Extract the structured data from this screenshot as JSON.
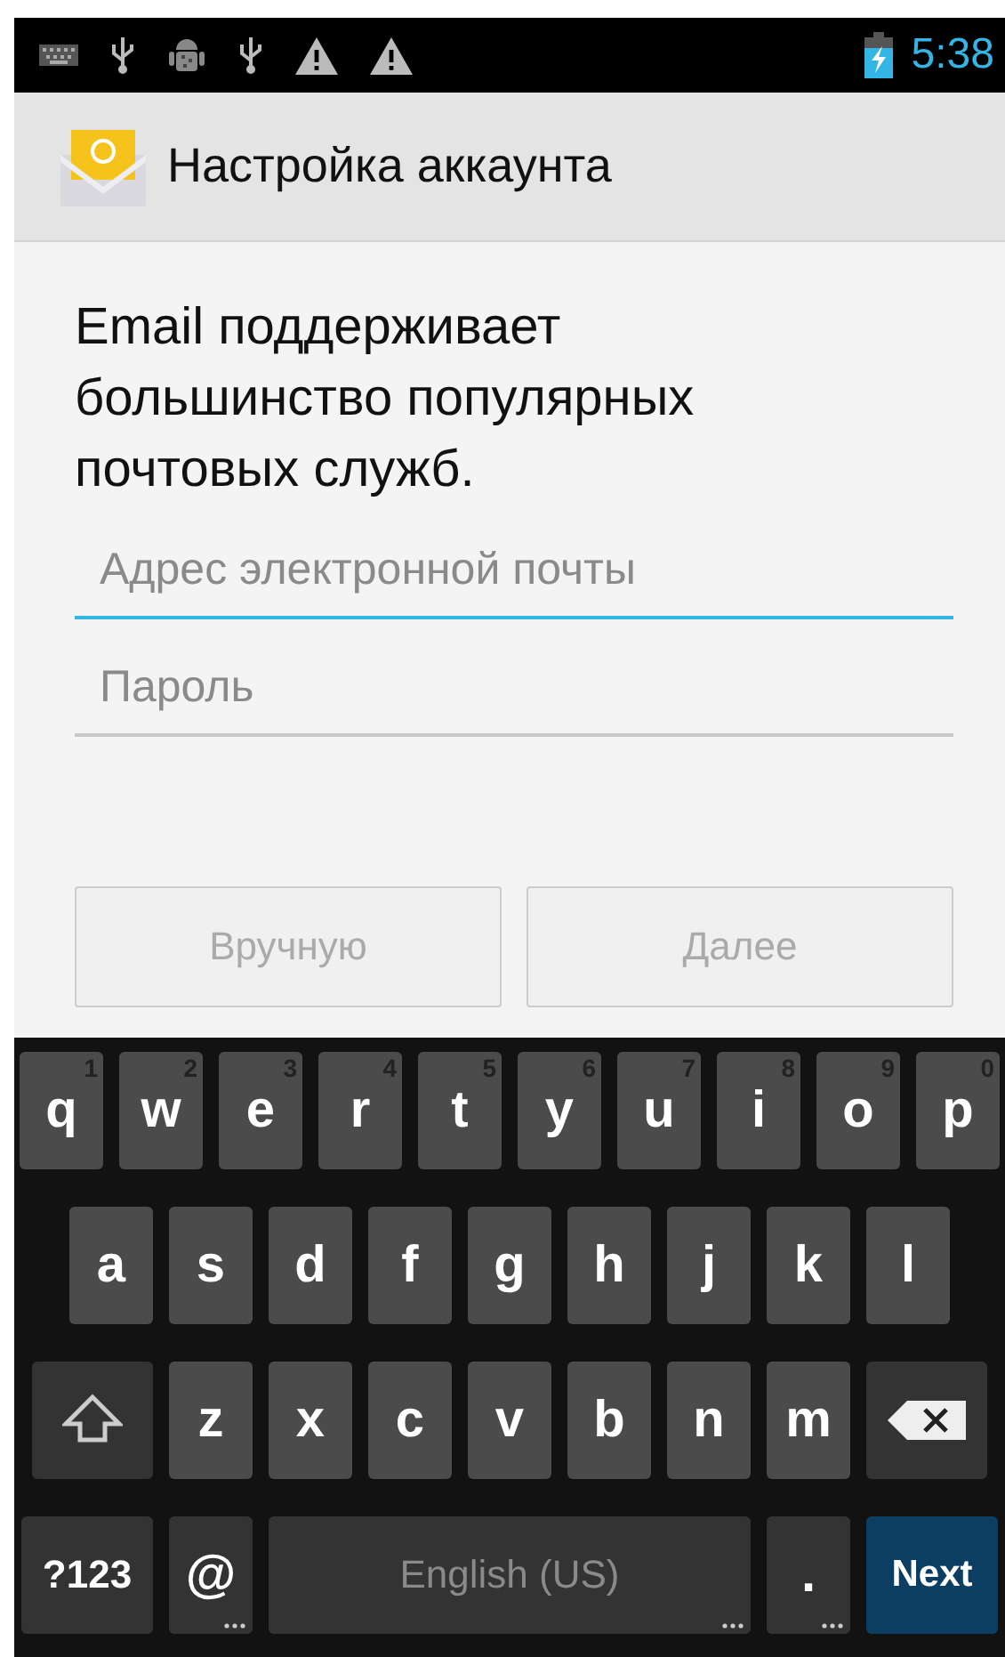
{
  "status_bar": {
    "time": "5:38"
  },
  "action_bar": {
    "title": "Настройка аккаунта"
  },
  "intro": "Email поддерживает большинство популярных почтовых служб.",
  "fields": [
    {
      "placeholder": "Адрес электронной почты",
      "focused": true
    },
    {
      "placeholder": "Пароль",
      "focused": false
    }
  ],
  "buttons": [
    {
      "label": "Вручную",
      "disabled": true
    },
    {
      "label": "Далее",
      "disabled": true
    }
  ],
  "keyboard": {
    "rows": [
      {
        "keys": [
          {
            "kind": "letter",
            "label": "q",
            "hint": "1"
          },
          {
            "kind": "letter",
            "label": "w",
            "hint": "2"
          },
          {
            "kind": "letter",
            "label": "e",
            "hint": "3"
          },
          {
            "kind": "letter",
            "label": "r",
            "hint": "4"
          },
          {
            "kind": "letter",
            "label": "t",
            "hint": "5"
          },
          {
            "kind": "letter",
            "label": "y",
            "hint": "6"
          },
          {
            "kind": "letter",
            "label": "u",
            "hint": "7"
          },
          {
            "kind": "letter",
            "label": "i",
            "hint": "8"
          },
          {
            "kind": "letter",
            "label": "o",
            "hint": "9"
          },
          {
            "kind": "letter",
            "label": "p",
            "hint": "0"
          }
        ]
      },
      {
        "keys": [
          {
            "kind": "letter",
            "label": "a"
          },
          {
            "kind": "letter",
            "label": "s"
          },
          {
            "kind": "letter",
            "label": "d"
          },
          {
            "kind": "letter",
            "label": "f"
          },
          {
            "kind": "letter",
            "label": "g"
          },
          {
            "kind": "letter",
            "label": "h"
          },
          {
            "kind": "letter",
            "label": "j"
          },
          {
            "kind": "letter",
            "label": "k"
          },
          {
            "kind": "letter",
            "label": "l"
          }
        ]
      },
      {
        "keys": [
          {
            "kind": "shift"
          },
          {
            "kind": "letter",
            "label": "z"
          },
          {
            "kind": "letter",
            "label": "x"
          },
          {
            "kind": "letter",
            "label": "c"
          },
          {
            "kind": "letter",
            "label": "v"
          },
          {
            "kind": "letter",
            "label": "b"
          },
          {
            "kind": "letter",
            "label": "n"
          },
          {
            "kind": "letter",
            "label": "m"
          },
          {
            "kind": "backspace"
          }
        ]
      },
      {
        "keys": [
          {
            "kind": "symbols",
            "label": "?123"
          },
          {
            "kind": "at",
            "label": "@"
          },
          {
            "kind": "space",
            "label": "English (US)"
          },
          {
            "kind": "period",
            "label": "."
          },
          {
            "kind": "action",
            "label": "Next"
          }
        ]
      }
    ]
  }
}
